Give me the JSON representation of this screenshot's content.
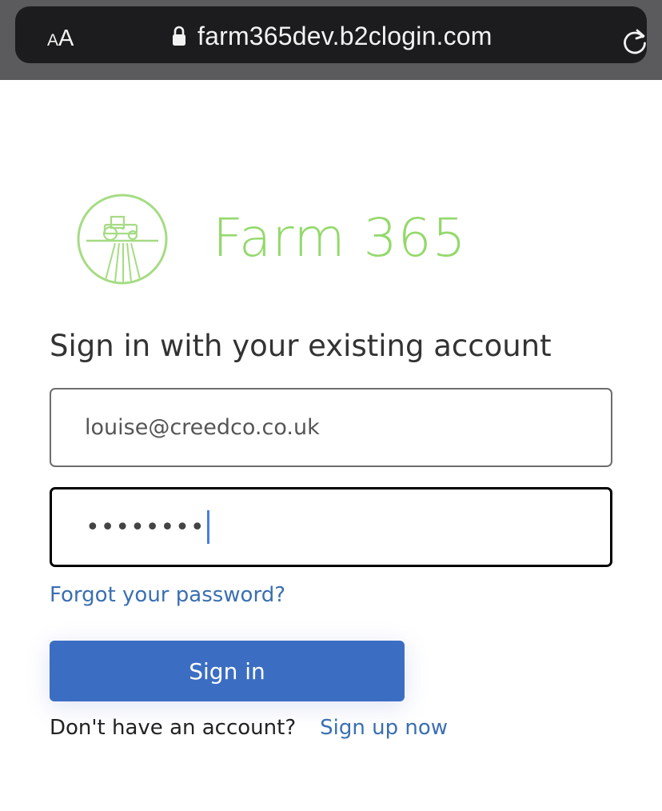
{
  "browser": {
    "text_size_small": "A",
    "text_size_large": "A",
    "url": "farm365dev.b2clogin.com"
  },
  "brand": {
    "name": "Farm 365",
    "color": "#93d96b"
  },
  "signin": {
    "heading": "Sign in with your existing account",
    "email_value": "louise@creedco.co.uk",
    "password_value": "••••••••",
    "forgot_link": "Forgot your password?",
    "button_label": "Sign in",
    "no_account_prompt": "Don't have an account?",
    "signup_link": "Sign up now",
    "button_color": "#3b6ec2",
    "link_color": "#3a6fb2"
  },
  "icons": {
    "lock": "lock-icon",
    "reload": "reload-icon",
    "logo": "tractor-circle-logo"
  }
}
